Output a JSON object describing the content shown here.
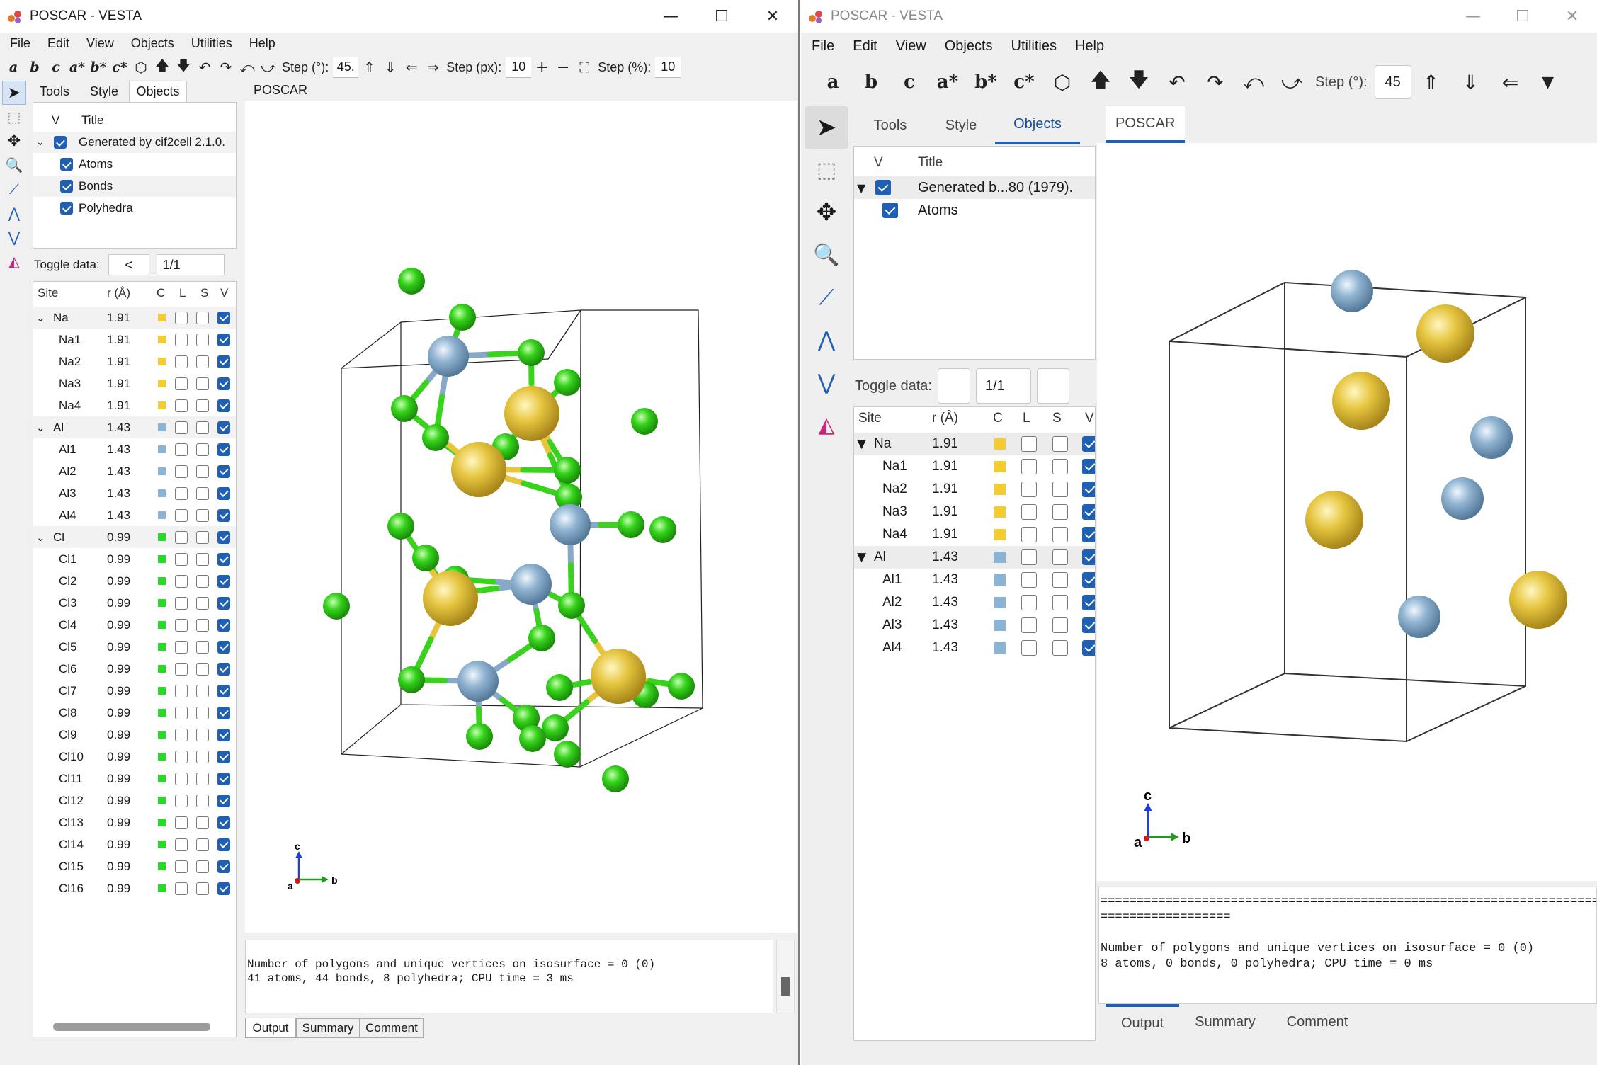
{
  "left": {
    "title": "POSCAR - VESTA",
    "menu": [
      "File",
      "Edit",
      "View",
      "Objects",
      "Utilities",
      "Help"
    ],
    "toolbar": {
      "axes": [
        "a",
        "b",
        "c",
        "a*",
        "b*",
        "c*"
      ],
      "step_deg_label": "Step (°):",
      "step_deg_value": "45.",
      "step_px_label": "Step (px):",
      "step_px_value": "10",
      "step_pct_label": "Step (%):",
      "step_pct_value": "10"
    },
    "panel_tabs": [
      "Tools",
      "Style",
      "Objects"
    ],
    "viewer_tab": "POSCAR",
    "tree": {
      "col_v": "V",
      "col_title": "Title",
      "root": "Generated by cif2cell 2.1.0.",
      "items": [
        "Atoms",
        "Bonds",
        "Polyhedra"
      ]
    },
    "toggle": {
      "label": "Toggle data:",
      "prev": "<",
      "value": "1/1"
    },
    "grid": {
      "headers": [
        "Site",
        "r (Å)",
        "C",
        "L",
        "S",
        "V"
      ],
      "rows": [
        {
          "site": "Na",
          "r": "1.91",
          "color": "#f5cc2e",
          "group": true
        },
        {
          "site": "Na1",
          "r": "1.91",
          "color": "#f5cc2e"
        },
        {
          "site": "Na2",
          "r": "1.91",
          "color": "#f5cc2e"
        },
        {
          "site": "Na3",
          "r": "1.91",
          "color": "#f5cc2e"
        },
        {
          "site": "Na4",
          "r": "1.91",
          "color": "#f5cc2e"
        },
        {
          "site": "Al",
          "r": "1.43",
          "color": "#8ab4d6",
          "group": true
        },
        {
          "site": "Al1",
          "r": "1.43",
          "color": "#8ab4d6"
        },
        {
          "site": "Al2",
          "r": "1.43",
          "color": "#8ab4d6"
        },
        {
          "site": "Al3",
          "r": "1.43",
          "color": "#8ab4d6"
        },
        {
          "site": "Al4",
          "r": "1.43",
          "color": "#8ab4d6"
        },
        {
          "site": "Cl",
          "r": "0.99",
          "color": "#22dd22",
          "group": true
        },
        {
          "site": "Cl1",
          "r": "0.99",
          "color": "#22dd22"
        },
        {
          "site": "Cl2",
          "r": "0.99",
          "color": "#22dd22"
        },
        {
          "site": "Cl3",
          "r": "0.99",
          "color": "#22dd22"
        },
        {
          "site": "Cl4",
          "r": "0.99",
          "color": "#22dd22"
        },
        {
          "site": "Cl5",
          "r": "0.99",
          "color": "#22dd22"
        },
        {
          "site": "Cl6",
          "r": "0.99",
          "color": "#22dd22"
        },
        {
          "site": "Cl7",
          "r": "0.99",
          "color": "#22dd22"
        },
        {
          "site": "Cl8",
          "r": "0.99",
          "color": "#22dd22"
        },
        {
          "site": "Cl9",
          "r": "0.99",
          "color": "#22dd22"
        },
        {
          "site": "Cl10",
          "r": "0.99",
          "color": "#22dd22"
        },
        {
          "site": "Cl11",
          "r": "0.99",
          "color": "#22dd22"
        },
        {
          "site": "Cl12",
          "r": "0.99",
          "color": "#22dd22"
        },
        {
          "site": "Cl13",
          "r": "0.99",
          "color": "#22dd22"
        },
        {
          "site": "Cl14",
          "r": "0.99",
          "color": "#22dd22"
        },
        {
          "site": "Cl15",
          "r": "0.99",
          "color": "#22dd22"
        },
        {
          "site": "Cl16",
          "r": "0.99",
          "color": "#22dd22"
        }
      ]
    },
    "axis_labels": {
      "a": "a",
      "b": "b",
      "c": "c"
    },
    "output": "Number of polygons and unique vertices on isosurface = 0 (0)\n41 atoms, 44 bonds, 8 polyhedra; CPU time = 3 ms",
    "bottom_tabs": [
      "Output",
      "Summary",
      "Comment"
    ]
  },
  "right": {
    "title": "POSCAR - VESTA",
    "menu": [
      "File",
      "Edit",
      "View",
      "Objects",
      "Utilities",
      "Help"
    ],
    "toolbar": {
      "axes": [
        "a",
        "b",
        "c",
        "a*",
        "b*",
        "c*"
      ],
      "step_deg_label": "Step (°):",
      "step_deg_value": "45"
    },
    "panel_tabs": [
      "Tools",
      "Style",
      "Objects"
    ],
    "viewer_tab": "POSCAR",
    "tree": {
      "col_v": "V",
      "col_title": "Title",
      "root": "Generated b...80 (1979).",
      "items": [
        "Atoms"
      ]
    },
    "toggle": {
      "label": "Toggle data:",
      "value": "1/1"
    },
    "grid": {
      "headers": [
        "Site",
        "r (Å)",
        "C",
        "L",
        "S",
        "V"
      ],
      "rows": [
        {
          "site": "Na",
          "r": "1.91",
          "color": "#f5cc2e",
          "group": true
        },
        {
          "site": "Na1",
          "r": "1.91",
          "color": "#f5cc2e"
        },
        {
          "site": "Na2",
          "r": "1.91",
          "color": "#f5cc2e"
        },
        {
          "site": "Na3",
          "r": "1.91",
          "color": "#f5cc2e"
        },
        {
          "site": "Na4",
          "r": "1.91",
          "color": "#f5cc2e"
        },
        {
          "site": "Al",
          "r": "1.43",
          "color": "#8ab4d6",
          "group": true
        },
        {
          "site": "Al1",
          "r": "1.43",
          "color": "#8ab4d6"
        },
        {
          "site": "Al2",
          "r": "1.43",
          "color": "#8ab4d6"
        },
        {
          "site": "Al3",
          "r": "1.43",
          "color": "#8ab4d6"
        },
        {
          "site": "Al4",
          "r": "1.43",
          "color": "#8ab4d6"
        }
      ]
    },
    "axis_labels": {
      "a": "a",
      "b": "b",
      "c": "c"
    },
    "output": "=========================================================================\n==================\n\nNumber of polygons and unique vertices on isosurface = 0 (0)\n8 atoms, 0 bonds, 0 polyhedra; CPU time = 0 ms",
    "bottom_tabs": [
      "Output",
      "Summary",
      "Comment"
    ]
  }
}
